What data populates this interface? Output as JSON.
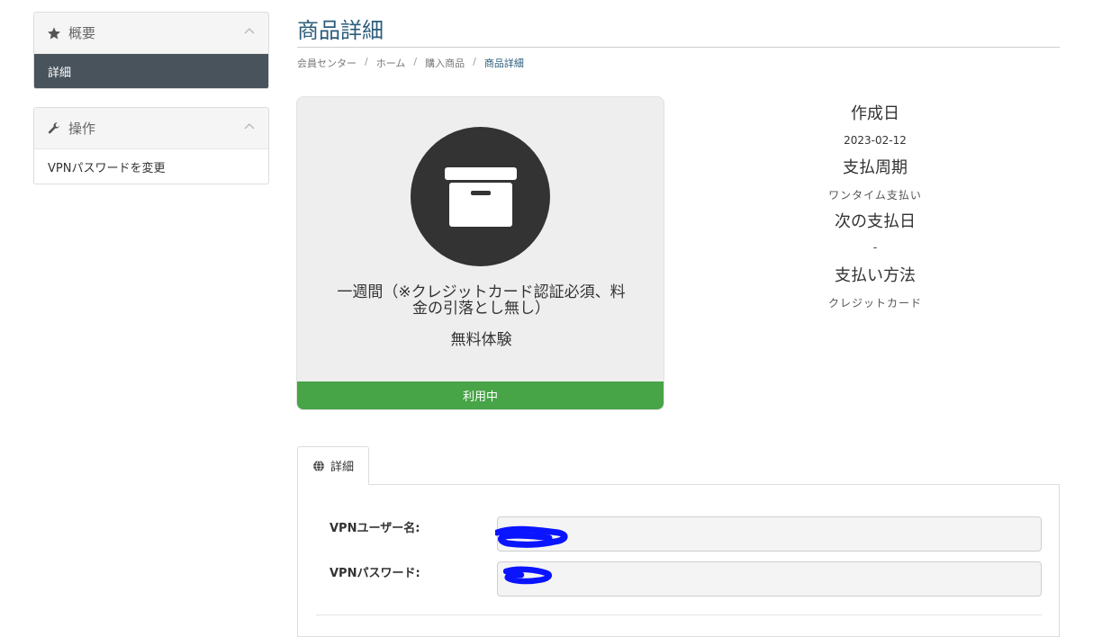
{
  "sidebar": {
    "overview": {
      "title": "概要",
      "icon": "star-icon",
      "items": [
        {
          "label": "詳細",
          "active": true
        }
      ]
    },
    "actions": {
      "title": "操作",
      "icon": "wrench-icon",
      "items": [
        {
          "label": "VPNパスワードを変更"
        }
      ]
    }
  },
  "page": {
    "title": "商品詳細",
    "breadcrumb": [
      "会員センター",
      "ホーム",
      "購入商品",
      "商品詳細"
    ],
    "separator": "/"
  },
  "product": {
    "icon": "archive-box-icon",
    "name": "一週間（※クレジットカード認証必須、料金の引落とし無し）",
    "name_line1": "一週間（※クレジットカード認証必須、料",
    "name_line2": "金の引落とし無し）",
    "subtitle": "無料体験",
    "status": "利用中",
    "status_color": "#47a447"
  },
  "info": {
    "created_label": "作成日",
    "created_value": "2023-02-12",
    "cycle_label": "支払周期",
    "cycle_value": "ワンタイム支払い",
    "next_label": "次の支払日",
    "next_value": "-",
    "method_label": "支払い方法",
    "method_value": "クレジットカード"
  },
  "tabs": [
    {
      "label": "詳細",
      "icon": "globe-icon",
      "active": true
    }
  ],
  "details": {
    "username_label": "VPNユーザー名:",
    "username_value": "",
    "password_label": "VPNパスワード:",
    "password_value": ""
  },
  "colors": {
    "title": "#2b5d7b",
    "sidebar_active": "#48535c",
    "redaction": "#0a14ff"
  }
}
